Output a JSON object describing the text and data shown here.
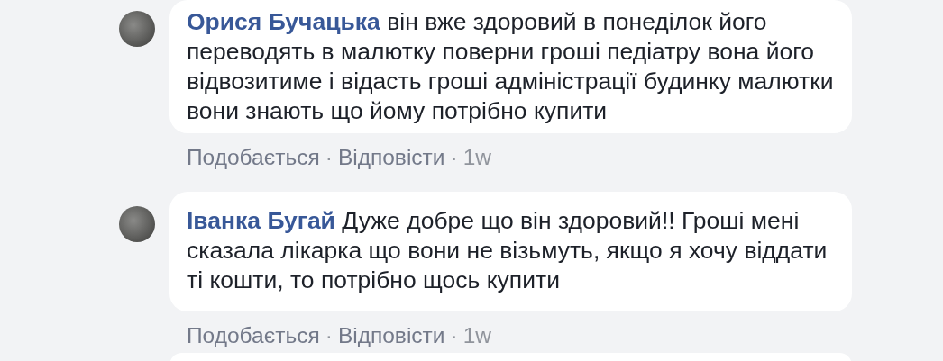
{
  "comments": [
    {
      "author": "Орися Бучацька",
      "text": "він вже здоровий в понеділок його переводять в малютку поверни гроші педіатру вона його відвозитиме і відасть гроші адміністрації будинку малютки вони знають що йому потрібно купити",
      "actions": [
        "Подобається",
        "Відповісти"
      ],
      "separators": [
        "·",
        "·"
      ],
      "time": "1w"
    },
    {
      "author": "Іванка Бугай",
      "text": "Дуже добре що він здоровий!! Гроші мені сказала лікарка що вони не візьмуть, якщо я хочу віддати ті кошти, то потрібно щось купити",
      "actions": [
        "Подобається",
        "Відповісти"
      ],
      "separators": [
        "·",
        "·"
      ],
      "time": "1w"
    }
  ]
}
